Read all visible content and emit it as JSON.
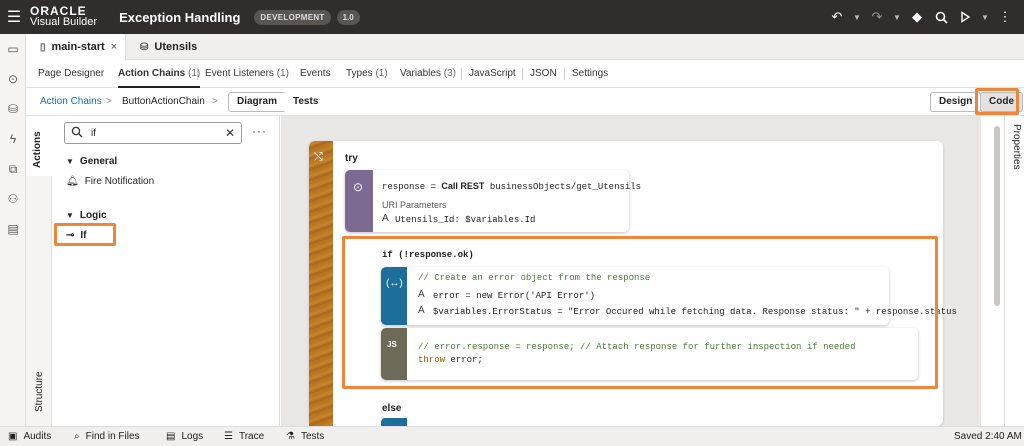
{
  "header": {
    "brand_line1": "ORACLE",
    "brand_line2": "Visual Builder",
    "app_title": "Exception Handling",
    "env_badge": "DEVELOPMENT",
    "version_badge": "1.0"
  },
  "file_tabs": [
    {
      "label": "main-start",
      "close": "×"
    },
    {
      "label": "Utensils"
    }
  ],
  "section_tabs": [
    {
      "label": "Page Designer",
      "count": ""
    },
    {
      "label": "Action Chains",
      "count": "(1)"
    },
    {
      "label": "Event Listeners",
      "count": "(1)"
    },
    {
      "label": "Events",
      "count": ""
    },
    {
      "label": "Types",
      "count": "(1)"
    },
    {
      "label": "Variables",
      "count": "(3)"
    },
    {
      "label": "JavaScript",
      "count": ""
    },
    {
      "label": "JSON",
      "count": ""
    },
    {
      "label": "Settings",
      "count": ""
    }
  ],
  "breadcrumb": {
    "root": "Action Chains",
    "current": "ButtonActionChain",
    "sep": ">"
  },
  "view_buttons": {
    "diagram": "Diagram",
    "tests": "Tests",
    "design": "Design",
    "code": "Code"
  },
  "side_tabs": {
    "actions": "Actions",
    "structure": "Structure",
    "properties": "Properties"
  },
  "actions_panel": {
    "search_value": "if",
    "groups": [
      {
        "title": "General",
        "items": [
          "Fire Notification"
        ]
      },
      {
        "title": "Logic",
        "items": [
          "If"
        ]
      }
    ]
  },
  "diagram": {
    "try_label": "try",
    "rest": {
      "line_prefix": "response =",
      "line_keyword": "Call REST",
      "line_suffix": "businessObjects/get_Utensils",
      "params_label": "URI Parameters",
      "param": "Utensils_Id: $variables.Id"
    },
    "if_label": "if (!response.ok)",
    "assign": {
      "comment": "// Create an error object from the response",
      "line1": "error = new Error('API Error')",
      "line2": "$variables.ErrorStatus = \"Error Occured while fetching data. Response status: \" + response.status"
    },
    "js": {
      "badge": "JS",
      "line1": "// error.response = response; // Attach response for further inspection if needed",
      "line2_kw": "throw",
      "line2_rest": "error;"
    },
    "else_label": "else"
  },
  "bottom_bar": {
    "audits": "Audits",
    "find": "Find in Files",
    "logs": "Logs",
    "trace": "Trace",
    "tests": "Tests",
    "status": "Saved 2:40 AM"
  },
  "colors": {
    "highlight": "#f0853a",
    "rest_bar": "#7d6a93",
    "if_bar": "#1d6e9a",
    "js_bar": "#6e6a58",
    "link": "#1a6aa8"
  }
}
